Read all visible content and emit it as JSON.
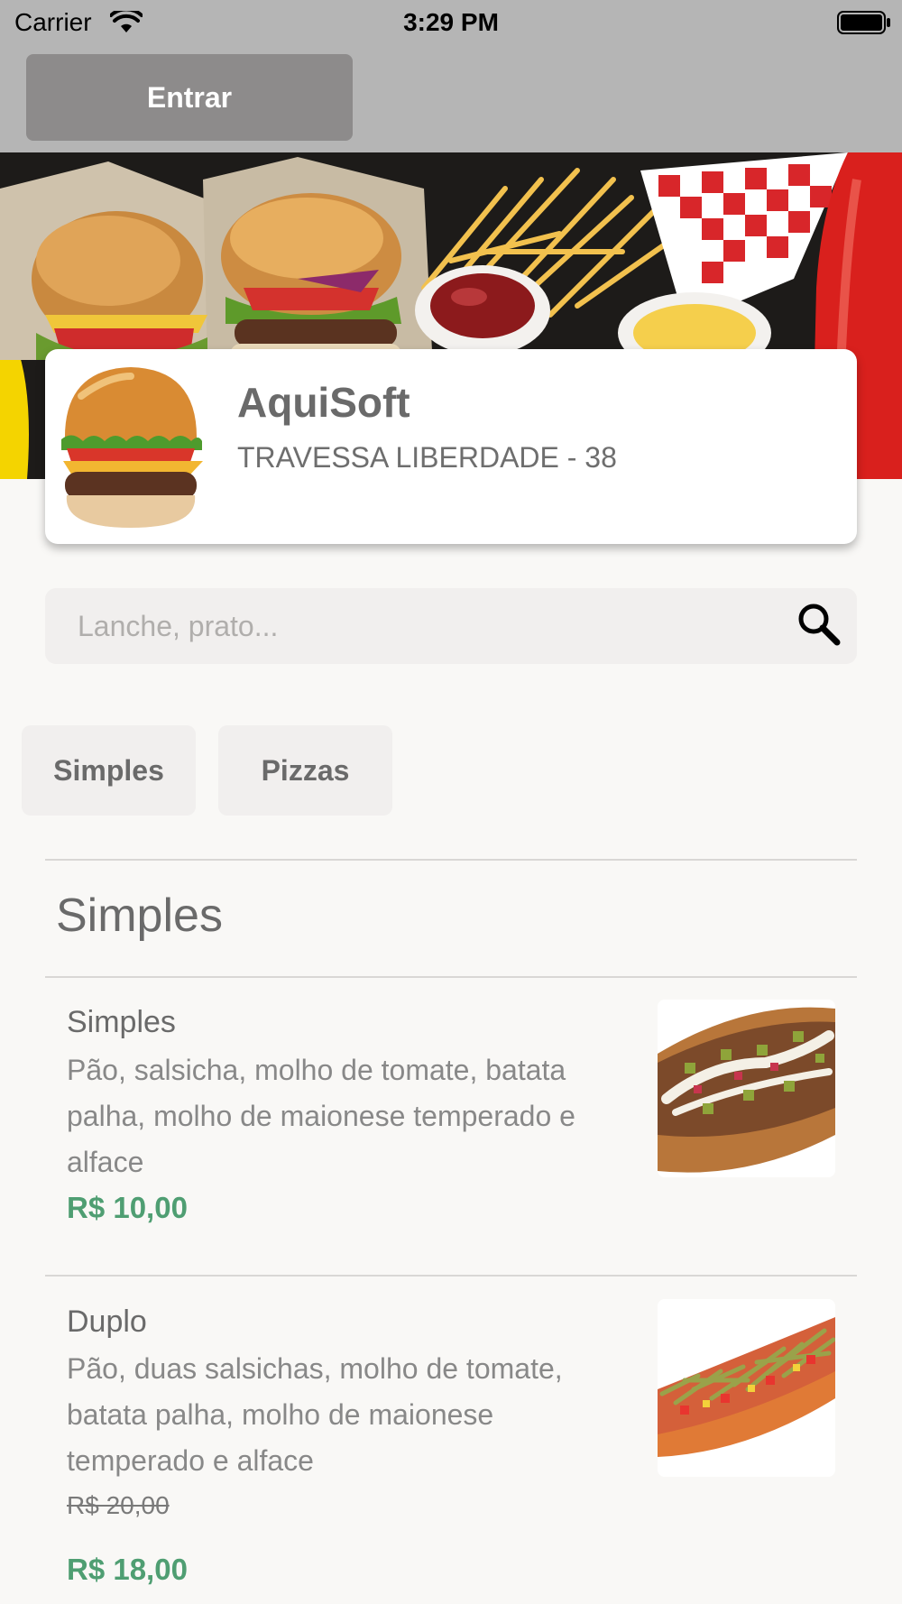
{
  "status_bar": {
    "carrier": "Carrier",
    "time": "3:29 PM"
  },
  "header": {
    "login_label": "Entrar"
  },
  "store": {
    "name": "AquiSoft",
    "address": "TRAVESSA LIBERDADE - 38"
  },
  "search": {
    "placeholder": "Lanche, prato...",
    "icon": "search-icon"
  },
  "categories": [
    {
      "label": "Simples"
    },
    {
      "label": "Pizzas"
    }
  ],
  "section": {
    "title": "Simples"
  },
  "products": [
    {
      "name": "Simples",
      "description": "Pão, salsicha, molho de tomate, batata palha, molho de maionese temperado e alface",
      "price": "R$ 10,00"
    },
    {
      "name": "Duplo",
      "description": "Pão, duas salsichas, molho de tomate, batata palha, molho de maionese temperado e alface",
      "old_price": "R$ 20,00",
      "price": "R$ 18,00"
    }
  ],
  "colors": {
    "top_bar": "#b5b5b5",
    "login_button": "#8d8b8b",
    "price": "#4f9e72",
    "background": "#f9f8f6"
  }
}
